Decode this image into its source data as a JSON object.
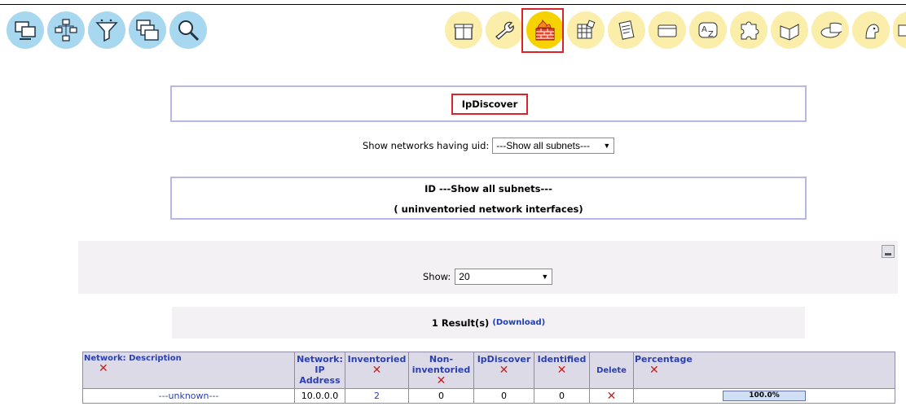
{
  "title": "IpDiscover",
  "uid_filter": {
    "label": "Show networks having uid:",
    "selected": "---Show all subnets---"
  },
  "subnet_box": {
    "line1": "ID ---Show all subnets---",
    "line2": "( uninventoried network interfaces)"
  },
  "show": {
    "label": "Show:",
    "selected": "20"
  },
  "result": {
    "count": "1 Result(s)",
    "download": "(Download)"
  },
  "table": {
    "headers": {
      "network_desc": "Network: Description",
      "network_ip": "Network: IP Address",
      "inventoried": "Inventoried",
      "non_inventoried": "Non-inventoried",
      "ipdiscover": "IpDiscover",
      "identified": "Identified",
      "delete": "Delete",
      "percentage": "Percentage"
    },
    "rows": [
      {
        "desc": "---unknown---",
        "ip": "10.0.0.0",
        "inventoried": "2",
        "non_inventoried": "0",
        "ipdiscover": "0",
        "identified": "0",
        "percentage": "100.0%"
      }
    ]
  },
  "toolbar_left": [
    "computers-icon",
    "network-tree-icon",
    "filter-funnel-icon",
    "windows-icon",
    "search-icon"
  ],
  "toolbar_right": [
    "gift-package-icon",
    "wrench-icon",
    "firewall-icon",
    "grid-table-icon",
    "document-scroll-icon",
    "card-icon",
    "a-z-sort-icon",
    "puzzle-icon",
    "book-icon",
    "pie-chart-icon",
    "user-help-icon",
    "partial-icon"
  ],
  "colors": {
    "accent": "#d9242a",
    "link": "#2b3fb0",
    "active_bubble": "#f6d200"
  }
}
